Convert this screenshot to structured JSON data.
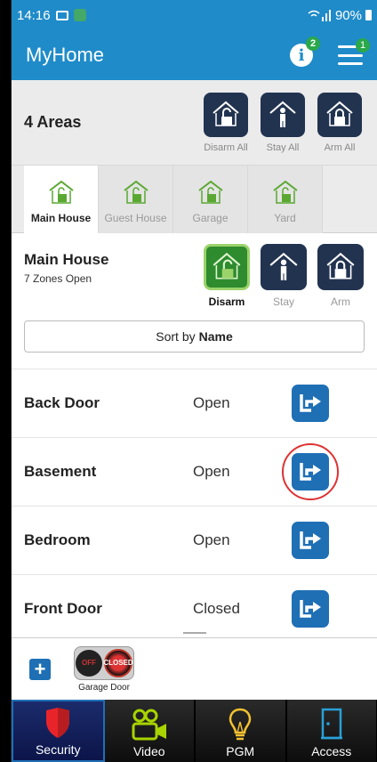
{
  "status_bar": {
    "time": "14:16",
    "battery": "90%"
  },
  "app_bar": {
    "title": "MyHome",
    "info_badge": "2",
    "menu_badge": "1"
  },
  "areas": {
    "title": "4 Areas",
    "actions": [
      {
        "label": "Disarm All",
        "icon": "house-unlocked-icon"
      },
      {
        "label": "Stay All",
        "icon": "person-stay-icon"
      },
      {
        "label": "Arm All",
        "icon": "house-locked-icon"
      }
    ]
  },
  "tabs": [
    {
      "label": "Main House",
      "active": true
    },
    {
      "label": "Guest House",
      "active": false
    },
    {
      "label": "Garage",
      "active": false
    },
    {
      "label": "Yard",
      "active": false
    }
  ],
  "zone_header": {
    "title": "Main House",
    "subtitle": "7 Zones Open",
    "actions": [
      {
        "label": "Disarm",
        "selected": true
      },
      {
        "label": "Stay",
        "selected": false
      },
      {
        "label": "Arm",
        "selected": false
      }
    ]
  },
  "sort": {
    "prefix": "Sort by",
    "field": "Name"
  },
  "zones": [
    {
      "name": "Back Door",
      "status": "Open"
    },
    {
      "name": "Basement",
      "status": "Open"
    },
    {
      "name": "Bedroom",
      "status": "Open"
    },
    {
      "name": "Front Door",
      "status": "Closed"
    }
  ],
  "quick_bar": {
    "add_label": "+",
    "pgm": {
      "label": "Garage Door",
      "off_text": "OFF",
      "state_text": "CLOSED"
    }
  },
  "bottom_nav": [
    {
      "label": "Security",
      "icon": "shield-icon",
      "active": true
    },
    {
      "label": "Video",
      "icon": "video-camera-icon",
      "active": false
    },
    {
      "label": "PGM",
      "icon": "lightbulb-icon",
      "active": false
    },
    {
      "label": "Access",
      "icon": "door-icon",
      "active": false
    }
  ],
  "colors": {
    "primary": "#1f8bc9",
    "action_dark": "#223350",
    "disarm_green": "#2e8b2e",
    "bypass_blue": "#1f6fb5"
  }
}
